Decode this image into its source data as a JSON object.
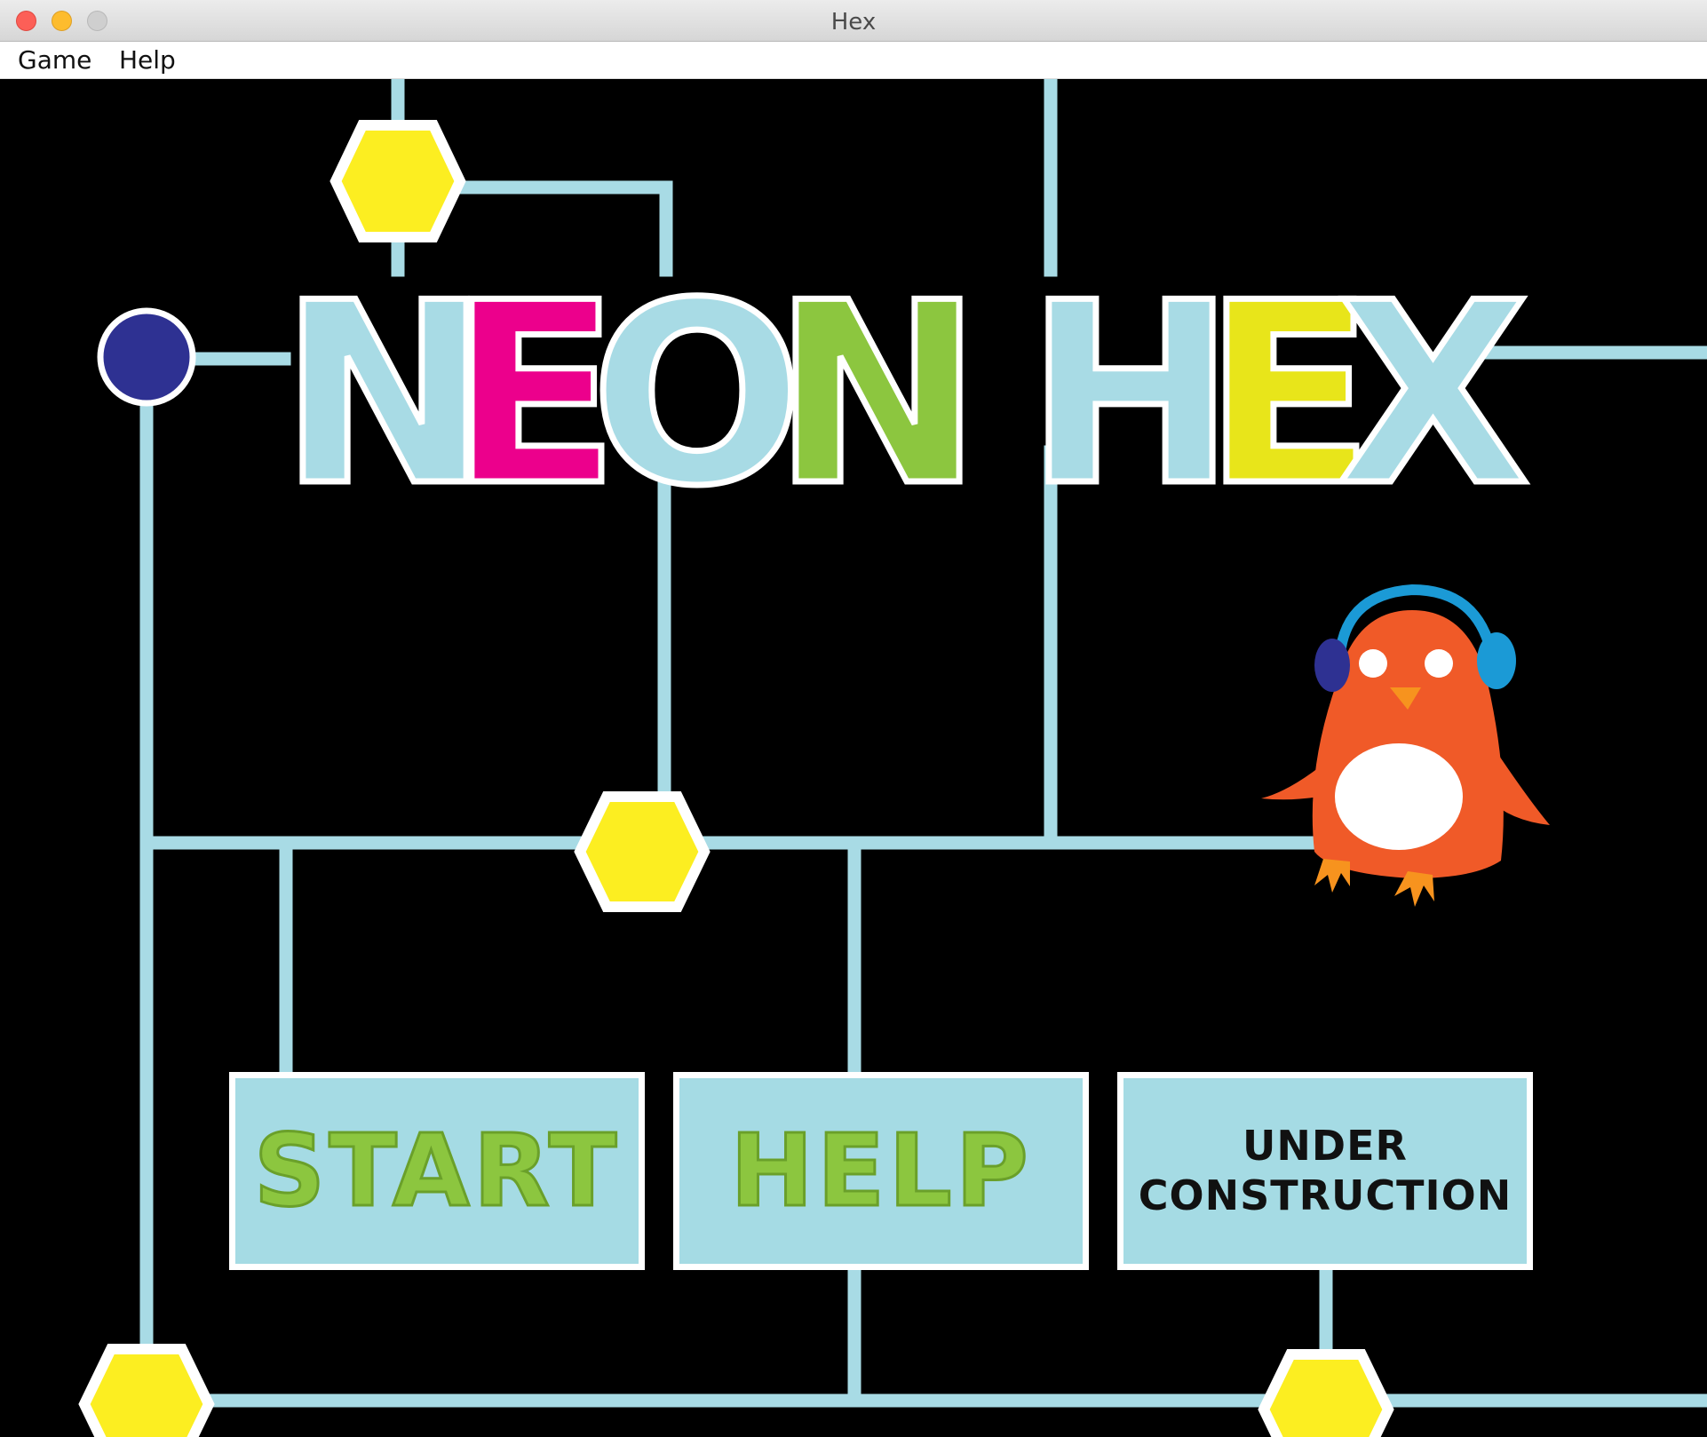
{
  "window": {
    "title": "Hex"
  },
  "menubar": {
    "items": [
      {
        "label": "Game"
      },
      {
        "label": "Help"
      }
    ]
  },
  "title": {
    "letters": [
      {
        "char": "N",
        "color": "#a8dbe5"
      },
      {
        "char": "E",
        "color": "#ec008c"
      },
      {
        "char": "O",
        "color": "#a8dbe5"
      },
      {
        "char": "N",
        "color": "#8cc63f"
      },
      {
        "char": "H",
        "color": "#a8dbe5"
      },
      {
        "char": "E",
        "color": "#e8e51a"
      },
      {
        "char": "X",
        "color": "#a8dbe5"
      }
    ]
  },
  "buttons": {
    "start_label": "START",
    "help_label": "HELP",
    "under_line1": "UNDER",
    "under_line2": "CONSTRUCTION"
  },
  "colors": {
    "background": "#000000",
    "circuit_line": "#a8dbe5",
    "hex_node": "#fcee21",
    "circle_node": "#2e3192",
    "penguin_body": "#f05a28",
    "headphones": "#1b9ad6"
  }
}
